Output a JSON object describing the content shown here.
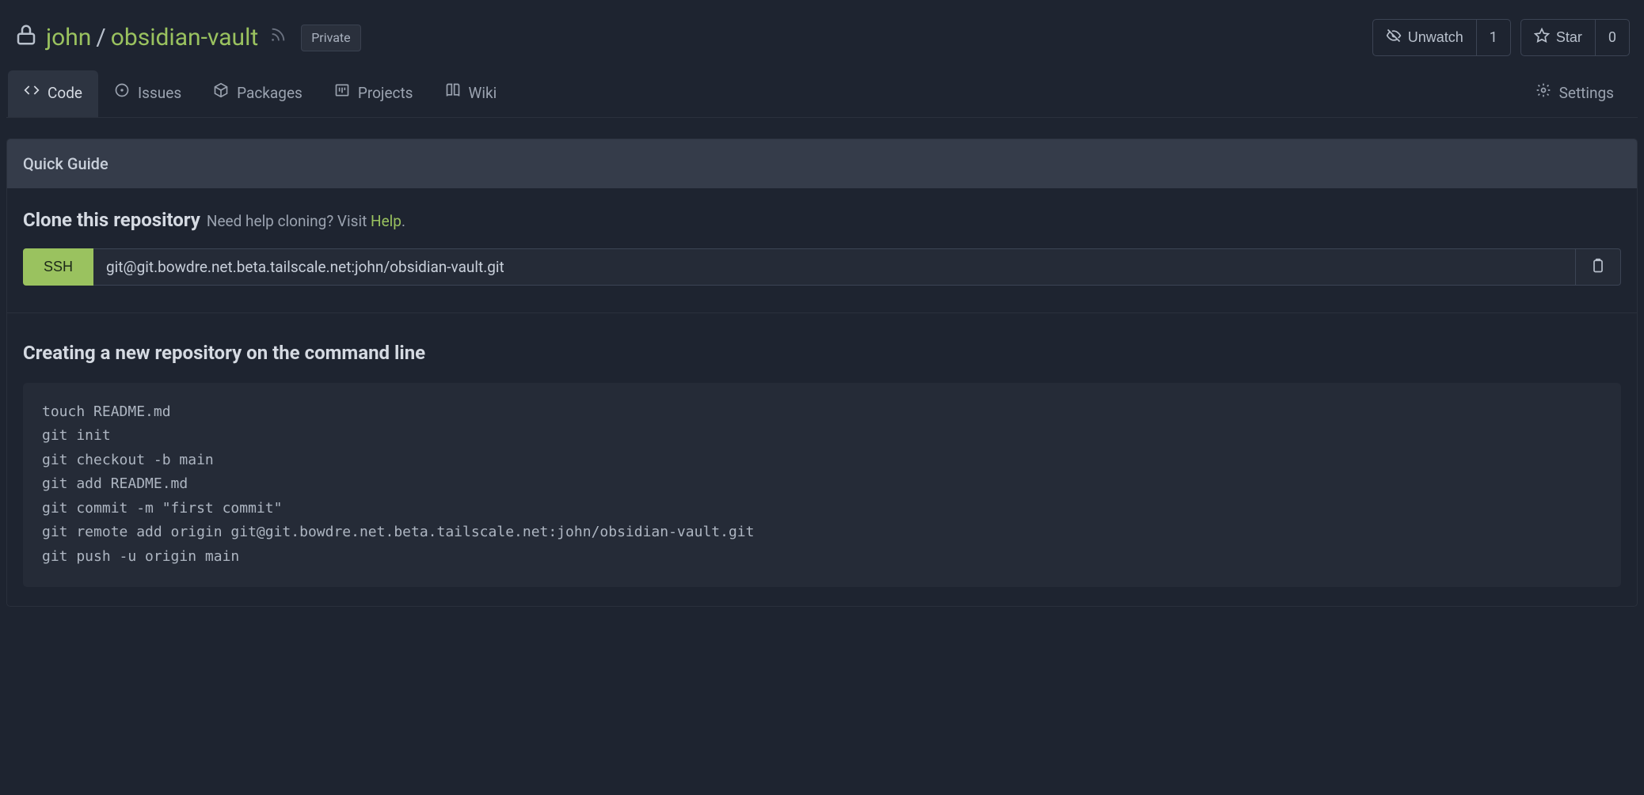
{
  "header": {
    "owner": "john",
    "separator": "/",
    "repo": "obsidian-vault",
    "badge": "Private"
  },
  "actions": {
    "watch": {
      "label": "Unwatch",
      "count": "1"
    },
    "star": {
      "label": "Star",
      "count": "0"
    }
  },
  "tabs": {
    "code": "Code",
    "issues": "Issues",
    "packages": "Packages",
    "projects": "Projects",
    "wiki": "Wiki",
    "settings": "Settings"
  },
  "guide": {
    "title": "Quick Guide",
    "clone_heading": "Clone this repository",
    "clone_help_prefix": "Need help cloning? Visit ",
    "clone_help_link": "Help",
    "clone_help_suffix": ".",
    "ssh_label": "SSH",
    "clone_url": "git@git.bowdre.net.beta.tailscale.net:john/obsidian-vault.git"
  },
  "create": {
    "heading": "Creating a new repository on the command line",
    "code": "touch README.md\ngit init\ngit checkout -b main\ngit add README.md\ngit commit -m \"first commit\"\ngit remote add origin git@git.bowdre.net.beta.tailscale.net:john/obsidian-vault.git\ngit push -u origin main"
  }
}
